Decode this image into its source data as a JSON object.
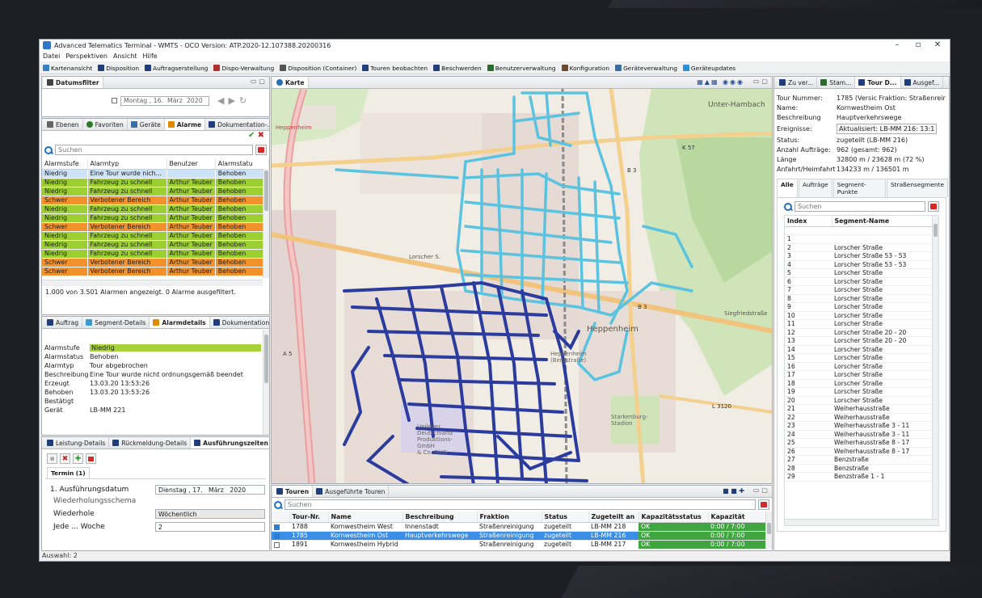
{
  "window": {
    "title": "Advanced Telematics Terminal - WMTS - OCO Version: ATP.2020-12.107388.20200316",
    "min": "–",
    "restore": "▫",
    "close": "✕"
  },
  "menu": [
    "Datei",
    "Perspektiven",
    "Ansicht",
    "Hilfe"
  ],
  "toolbar": [
    {
      "label": "Kartenansicht",
      "icon": "map-icon",
      "color": "#3b7fc4"
    },
    {
      "label": "Disposition",
      "icon": "truck-icon",
      "color": "#1f3e7a"
    },
    {
      "label": "Auftragserstellung",
      "icon": "truck-icon",
      "color": "#1f3e7a"
    },
    {
      "label": "Dispo-Verwaltung",
      "icon": "truck-icon",
      "color": "#b03030"
    },
    {
      "label": "Disposition (Container)",
      "icon": "monitor-icon",
      "color": "#555"
    },
    {
      "label": "Touren beobachten",
      "icon": "truck-icon",
      "color": "#1f3e7a"
    },
    {
      "label": "Beschwerden",
      "icon": "truck-icon",
      "color": "#1f3e7a"
    },
    {
      "label": "Benutzerverwaltung",
      "icon": "users-icon",
      "color": "#2d6a2d"
    },
    {
      "label": "Konfiguration",
      "icon": "gear-icon",
      "color": "#6a4a2d"
    },
    {
      "label": "Geräteverwaltung",
      "icon": "monitor-icon",
      "color": "#3a6ea0"
    },
    {
      "label": "Geräteupdates",
      "icon": "update-icon",
      "color": "#2c8fd8"
    }
  ],
  "datefilter": {
    "tab": "Datumsfilter",
    "day": "Montag",
    "date": "16.",
    "month": "März",
    "year": "2020"
  },
  "alarmpanel": {
    "tabs": [
      "Ebenen",
      "Favoriten",
      "Geräte",
      "Alarme",
      "Dokumentation-..."
    ],
    "search_placeholder": "Suchen",
    "headers": [
      "Alarmstufe",
      "Alarmtyp",
      "Benutzer",
      "Alarmstatu"
    ],
    "rows": [
      {
        "level": "Niedrig",
        "type": "Eine Tour wurde nich...",
        "user": "",
        "status": "Behoben",
        "kind": "sel"
      },
      {
        "level": "Niedrig",
        "type": "Fahrzeug zu schnell",
        "user": "Arthur Teuber",
        "status": "Behoben",
        "kind": "niedrig"
      },
      {
        "level": "Niedrig",
        "type": "Fahrzeug zu schnell",
        "user": "Arthur Teuber",
        "status": "Behoben",
        "kind": "niedrig"
      },
      {
        "level": "Schwer",
        "type": "Verbotener Bereich",
        "user": "Arthur Teuber",
        "status": "Behoben",
        "kind": "schwer"
      },
      {
        "level": "Niedrig",
        "type": "Fahrzeug zu schnell",
        "user": "Arthur Teuber",
        "status": "Behoben",
        "kind": "niedrig"
      },
      {
        "level": "Niedrig",
        "type": "Fahrzeug zu schnell",
        "user": "Arthur Teuber",
        "status": "Behoben",
        "kind": "niedrig"
      },
      {
        "level": "Schwer",
        "type": "Verbotener Bereich",
        "user": "Arthur Teuber",
        "status": "Behoben",
        "kind": "schwer"
      },
      {
        "level": "Niedrig",
        "type": "Fahrzeug zu schnell",
        "user": "Arthur Teuber",
        "status": "Behoben",
        "kind": "niedrig"
      },
      {
        "level": "Niedrig",
        "type": "Fahrzeug zu schnell",
        "user": "Arthur Teuber",
        "status": "Behoben",
        "kind": "niedrig"
      },
      {
        "level": "Niedrig",
        "type": "Fahrzeug zu schnell",
        "user": "Arthur Teuber",
        "status": "Behoben",
        "kind": "niedrig"
      },
      {
        "level": "Schwer",
        "type": "Verbotener Bereich",
        "user": "Arthur Teuber",
        "status": "Behoben",
        "kind": "schwer"
      },
      {
        "level": "Schwer",
        "type": "Verbotener Bereich",
        "user": "Arthur Teuber",
        "status": "Behoben",
        "kind": "schwer"
      }
    ],
    "status": "1.000 von 3.501 Alarmen angezeigt. 0 Alarme ausgefiltert."
  },
  "alarmdetails": {
    "tabs": [
      "Auftrag",
      "Segment-Details",
      "Alarmdetails",
      "Dokumentation-..."
    ],
    "fields": [
      {
        "k": "Alarmstufe",
        "v": "Niedrig"
      },
      {
        "k": "Alarmstatus",
        "v": "Behoben"
      },
      {
        "k": "Alarmtyp",
        "v": "Tour abgebrochen"
      },
      {
        "k": "Beschreibung",
        "v": "Eine Tour wurde nicht ordnungsgemäß beendet"
      },
      {
        "k": "Erzeugt",
        "v": "13.03.20 13:53:26"
      },
      {
        "k": "Behoben",
        "v": "13.03.20 13:53:26"
      },
      {
        "k": "Bestätigt",
        "v": ""
      },
      {
        "k": "Gerät",
        "v": "LB-MM 221"
      }
    ]
  },
  "execution": {
    "tabs": [
      "Leistung-Details",
      "Rückmeldung-Details",
      "Ausführungszeiten"
    ],
    "term_tab": "Termin (1)",
    "first_label": "1. Ausführungsdatum",
    "first_day": "Dienstag",
    "first_date": "17.",
    "first_month": "März",
    "first_year": "2020",
    "schema_label": "Wiederholungsschema",
    "repeat_label": "Wiederhole",
    "repeat_value": "Wöchentlich",
    "every_label": "Jede ... Woche",
    "every_value": "2"
  },
  "map": {
    "tab": "Karte",
    "labels": {
      "hambach": "Unter-Hambach",
      "heppenheim": "Heppenheim",
      "heppenheim2": "Heppenheim",
      "lorscher": "Lorscher S.",
      "b3a": "B 3",
      "b3b": "B 3",
      "k57": "K 57",
      "a5": "A 5",
      "l3120": "L 3120",
      "siegfried": "Siegfriedstraße",
      "unilever": "Unilever\nDeutschland\nProduktions-\nGmbH\n& Co. OHG",
      "starkenburg": "Starkenburg-\nStadion",
      "bensheim": "Heppenheim\n(Bergstraße)"
    },
    "colors": {
      "light_tour": "#5bc3e0",
      "dark_tour": "#2b3c9e"
    }
  },
  "tours": {
    "tabs": [
      "Touren",
      "Ausgeführte Touren"
    ],
    "search_placeholder": "Suchen",
    "headers": [
      "Tour-Nr.",
      "Name",
      "Beschreibung",
      "Fraktion",
      "Status",
      "Zugeteilt an",
      "Kapazitätsstatus",
      "Kapazität"
    ],
    "rows": [
      {
        "nr": "1788",
        "name": "Kornwestheim West",
        "desc": "Innenstadt",
        "frak": "Straßenreinigung",
        "status": "zugeteilt",
        "assigned": "LB-MM 218",
        "capstat": "OK",
        "cap": "0:00 / 7:00",
        "checked": true,
        "sel": false
      },
      {
        "nr": "1785",
        "name": "Kornwestheim Ost",
        "desc": "Hauptverkehrswege",
        "frak": "Straßenreinigung",
        "status": "zugeteilt",
        "assigned": "LB-MM 216",
        "capstat": "OK",
        "cap": "0:00 / 7:00",
        "checked": true,
        "sel": true
      },
      {
        "nr": "1891",
        "name": "Kornwestheim Hybrid",
        "desc": "",
        "frak": "Straßenreinigung",
        "status": "zugeteilt",
        "assigned": "LB-MM 217",
        "capstat": "OK",
        "cap": "0:00 / 7:00",
        "checked": false,
        "sel": false
      }
    ]
  },
  "right": {
    "tabs": [
      "Zu ver...",
      "Stam...",
      "Tour D...",
      "Ausgef..."
    ],
    "info": [
      {
        "k": "Tour Nummer:",
        "v": "1785 (Versic Fraktion: Straßenreir"
      },
      {
        "k": "Name:",
        "v": "Kornwestheim Ost"
      },
      {
        "k": "Beschreibung",
        "v": "Hauptverkehrswege"
      },
      {
        "k": "Ereignisse:",
        "v": "Aktualisiert: LB-MM 216: 13:1"
      },
      {
        "k": "Status:",
        "v": "zugeteilt (LB-MM 216)"
      },
      {
        "k": "Anzahl Aufträge:",
        "v": "962 (gesamt: 962)"
      },
      {
        "k": "Länge",
        "v": "32800 m / 23628 m  (72 %)"
      },
      {
        "k": "Anfahrt/Heimfahrt",
        "v": "134233 m / 136501 m"
      }
    ],
    "subtabs": [
      "Alle",
      "Aufträge",
      "Segment-Punkte",
      "Straßensegmente"
    ],
    "search_placeholder": "Suchen",
    "seg_headers": [
      "Index",
      "Segment-Name"
    ],
    "segments": [
      {
        "i": "",
        "n": ""
      },
      {
        "i": "1",
        "n": ""
      },
      {
        "i": "2",
        "n": "Lorscher Straße"
      },
      {
        "i": "3",
        "n": "Lorscher Straße 53 - 53"
      },
      {
        "i": "4",
        "n": "Lorscher Straße 53 - 53"
      },
      {
        "i": "5",
        "n": "Lorscher Straße"
      },
      {
        "i": "6",
        "n": "Lorscher Straße"
      },
      {
        "i": "7",
        "n": "Lorscher Straße"
      },
      {
        "i": "8",
        "n": "Lorscher Straße"
      },
      {
        "i": "9",
        "n": "Lorscher Straße"
      },
      {
        "i": "10",
        "n": "Lorscher Straße"
      },
      {
        "i": "11",
        "n": "Lorscher Straße"
      },
      {
        "i": "12",
        "n": "Lorscher Straße 20 - 20"
      },
      {
        "i": "13",
        "n": "Lorscher Straße 20 - 20"
      },
      {
        "i": "14",
        "n": "Lorscher Straße"
      },
      {
        "i": "15",
        "n": "Lorscher Straße"
      },
      {
        "i": "16",
        "n": "Lorscher Straße"
      },
      {
        "i": "17",
        "n": "Lorscher Straße"
      },
      {
        "i": "18",
        "n": "Lorscher Straße"
      },
      {
        "i": "19",
        "n": "Lorscher Straße"
      },
      {
        "i": "20",
        "n": "Lorscher Straße"
      },
      {
        "i": "21",
        "n": "Weiherhausstraße"
      },
      {
        "i": "22",
        "n": "Weiherhausstraße"
      },
      {
        "i": "23",
        "n": "Weiherhausstraße 3 - 11"
      },
      {
        "i": "24",
        "n": "Weiherhausstraße 3 - 11"
      },
      {
        "i": "25",
        "n": "Weiherhausstraße 8 - 17"
      },
      {
        "i": "26",
        "n": "Weiherhausstraße 8 - 17"
      },
      {
        "i": "27",
        "n": "Benzstraße"
      },
      {
        "i": "28",
        "n": "Benzstraße"
      },
      {
        "i": "29",
        "n": "Benzstraße 1 - 1"
      }
    ]
  },
  "statusbar": "Auswahl: 2"
}
